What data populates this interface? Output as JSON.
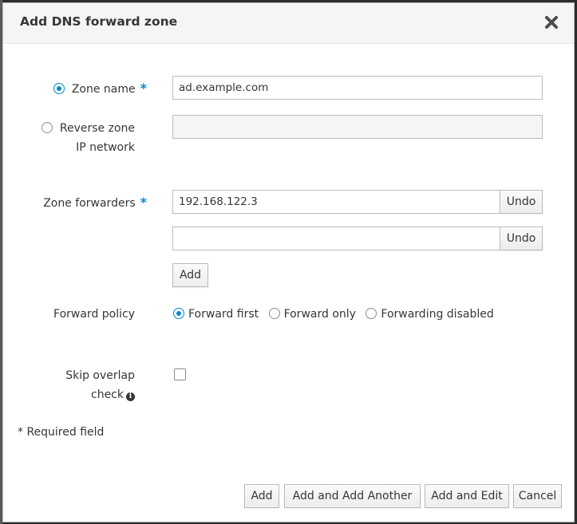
{
  "dialog": {
    "title": "Add DNS forward zone",
    "close_icon": "close-icon"
  },
  "form": {
    "zone_name": {
      "label": "Zone name",
      "required_marker": "*",
      "value": "ad.example.com",
      "selected": true
    },
    "reverse_zone": {
      "label_line1": "Reverse zone",
      "label_line2": "IP network",
      "value": "",
      "selected": false
    },
    "zone_forwarders": {
      "label": "Zone forwarders",
      "required_marker": "*",
      "entries": [
        {
          "value": "192.168.122.3",
          "undo_label": "Undo"
        },
        {
          "value": "",
          "undo_label": "Undo"
        }
      ],
      "add_label": "Add"
    },
    "forward_policy": {
      "label": "Forward policy",
      "options": [
        {
          "label": "Forward first",
          "selected": true
        },
        {
          "label": "Forward only",
          "selected": false
        },
        {
          "label": "Forwarding disabled",
          "selected": false
        }
      ]
    },
    "skip_overlap": {
      "label_line1": "Skip overlap",
      "label_line2": "check",
      "checked": false,
      "info_icon": "info-icon"
    },
    "required_note": "* Required field"
  },
  "footer": {
    "add": "Add",
    "add_another": "Add and Add Another",
    "add_edit": "Add and Edit",
    "cancel": "Cancel"
  },
  "colors": {
    "accent": "#0088ce",
    "header_bg": "#f5f5f5"
  }
}
